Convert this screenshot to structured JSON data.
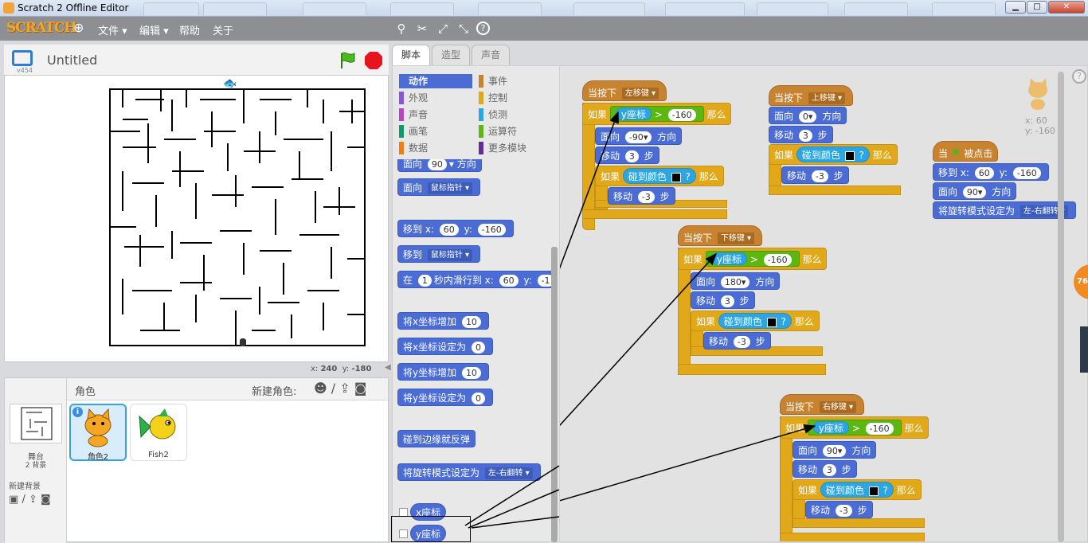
{
  "window": {
    "title": "Scratch 2 Offline Editor"
  },
  "menubar": {
    "logo": "SCRATCH",
    "items": [
      "文件",
      "编辑",
      "帮助",
      "关于"
    ]
  },
  "stage": {
    "project_title": "Untitled",
    "version": "v454",
    "coords": {
      "x": "240",
      "y": "-180"
    }
  },
  "sprites_panel": {
    "header": "角色",
    "new_sprite_label": "新建角色:",
    "stage_label": "舞台",
    "stage_backdrops": "2 背景",
    "new_backdrop_label": "新建背景",
    "sprites": [
      {
        "name": "角色2",
        "selected": true
      },
      {
        "name": "Fish2",
        "selected": false
      }
    ]
  },
  "tabs": [
    "脚本",
    "造型",
    "声音"
  ],
  "categories": [
    {
      "label": "动作",
      "color": "#4a6cd4",
      "selected": true
    },
    {
      "label": "外观",
      "color": "#8a55d7"
    },
    {
      "label": "声音",
      "color": "#bb42c3"
    },
    {
      "label": "画笔",
      "color": "#0e9a6c"
    },
    {
      "label": "数据",
      "color": "#ee7d16"
    },
    {
      "label": "事件",
      "color": "#c88330"
    },
    {
      "label": "控制",
      "color": "#e1a91a"
    },
    {
      "label": "侦测",
      "color": "#2ca5e2"
    },
    {
      "label": "运算符",
      "color": "#5cb712"
    },
    {
      "label": "更多模块",
      "color": "#632d99"
    }
  ],
  "palette": {
    "point_dir": "面向",
    "dir_val": "90",
    "direction": "方向",
    "point_towards": "面向",
    "mouse_pointer": "鼠标指针",
    "goto_xy": "移到 x:",
    "x_val": "60",
    "y_label": "y:",
    "y_val": "-160",
    "goto": "移到",
    "glide_in": "在",
    "glide_secs": "1",
    "glide_text": "秒内滑行到 x:",
    "glide_y": "-1",
    "change_x": "将x坐标增加",
    "change_x_val": "10",
    "set_x": "将x坐标设定为",
    "set_x_val": "0",
    "change_y": "将y坐标增加",
    "change_y_val": "10",
    "set_y": "将y坐标设定为",
    "set_y_val": "0",
    "bounce": "碰到边缘就反弹",
    "rotation_style": "将旋转模式设定为",
    "rotation_val": "左-右翻转",
    "x_pos": "x座标",
    "y_pos": "y座标"
  },
  "scripts": {
    "when_key": "当按下",
    "left_key": "左移键",
    "up_key": "上移键",
    "down_key": "下移键",
    "right_key": "右移键",
    "if": "如果",
    "then": "那么",
    "y_reporter": "y座标",
    "gt": ">",
    "cmp_val": "-160",
    "point": "面向",
    "direction": "方向",
    "dir_left": "-90",
    "dir_up": "0",
    "dir_down": "180",
    "dir_right": "90",
    "move": "移动",
    "steps": "步",
    "move_val": "3",
    "move_back": "-3",
    "touching_color": "碰到颜色",
    "question": "?",
    "when_flag": "当",
    "clicked": "被点击",
    "goto_x": "移到 x:",
    "x_val": "60",
    "y_label": "y:",
    "y_val": "-160",
    "rotation_style": "将旋转模式设定为",
    "rotation_val": "左-右翻转"
  },
  "sprite_info": {
    "x_label": "x: 60",
    "y_label": "y: -160"
  },
  "badge": "76"
}
